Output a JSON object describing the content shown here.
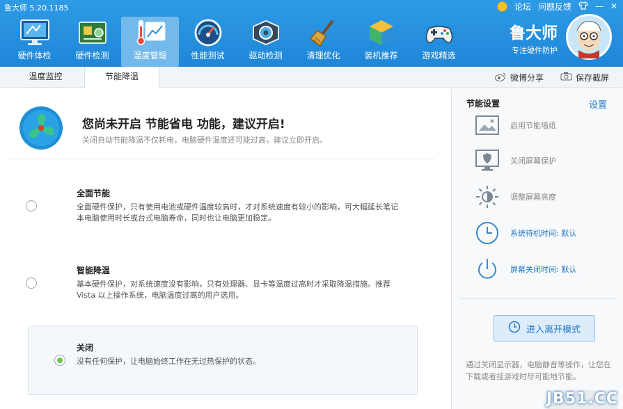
{
  "window": {
    "title": "鲁大师 5.20.1185"
  },
  "system": {
    "forum": "论坛",
    "feedback": "问题反馈",
    "skin_icon": "shirt-icon",
    "minimize": "—",
    "close": "✕"
  },
  "nav": {
    "items": [
      {
        "label": "硬件体检",
        "icon": "monitor-icon"
      },
      {
        "label": "硬件检测",
        "icon": "circuit-board-icon"
      },
      {
        "label": "温度管理",
        "icon": "thermometer-chart-icon"
      },
      {
        "label": "性能测试",
        "icon": "gauge-icon"
      },
      {
        "label": "驱动检测",
        "icon": "gear-box-icon"
      },
      {
        "label": "清理优化",
        "icon": "broom-icon"
      },
      {
        "label": "装机推荐",
        "icon": "cube-icon"
      },
      {
        "label": "游戏精选",
        "icon": "gamepad-icon"
      }
    ],
    "active_index": 2
  },
  "brand": {
    "name": "鲁大师",
    "slogan": "专注硬件防护"
  },
  "tabs": [
    {
      "label": "温度监控"
    },
    {
      "label": "节能降温"
    }
  ],
  "active_tab": 1,
  "toolbar": {
    "weibo_share": "微博分享",
    "save_screenshot": "保存截屏"
  },
  "banner": {
    "headline": "您尚未开启 节能省电 功能，建议开启!",
    "subtext": "关闭自动节能降温不仅耗电，电脑硬件温度还可能过高，建议立即开启。"
  },
  "options": [
    {
      "title": "全面节能",
      "desc": "全面硬件保护，只有使用电池或硬件温度较高时，才对系统速度有较小的影响，可大幅延长笔记本电脑使用时长或台式电脑寿命，同时也让电脑更加稳定。",
      "selected": false
    },
    {
      "title": "智能降温",
      "desc": "基本硬件保护，对系统速度没有影响，只有处理器、显卡等温度过高时才采取降温措施。推荐 Vista 以上操作系统，电脑温度过高的用户选用。",
      "selected": false
    },
    {
      "title": "关闭",
      "desc": "没有任何保护，让电脑始终工作在无过热保护的状态。",
      "selected": true
    }
  ],
  "settings": {
    "title": "节能设置",
    "link": "设置",
    "items": [
      {
        "label": "启用节能墙纸",
        "icon": "picture-icon"
      },
      {
        "label": "关闭屏幕保护",
        "icon": "monitor-shield-icon"
      },
      {
        "label": "调整屏幕亮度",
        "icon": "brightness-icon"
      },
      {
        "label": "系统待机时间: 默认",
        "icon": "clock-icon"
      },
      {
        "label": "屏幕关闭时间: 默认",
        "icon": "power-icon"
      }
    ],
    "leave_mode_button": "进入离开模式",
    "note": "通过关闭显示器，电脑静音等操作，让您在下载或者挂游戏时尽可能地节能。"
  },
  "watermark": "JB51.CC"
}
